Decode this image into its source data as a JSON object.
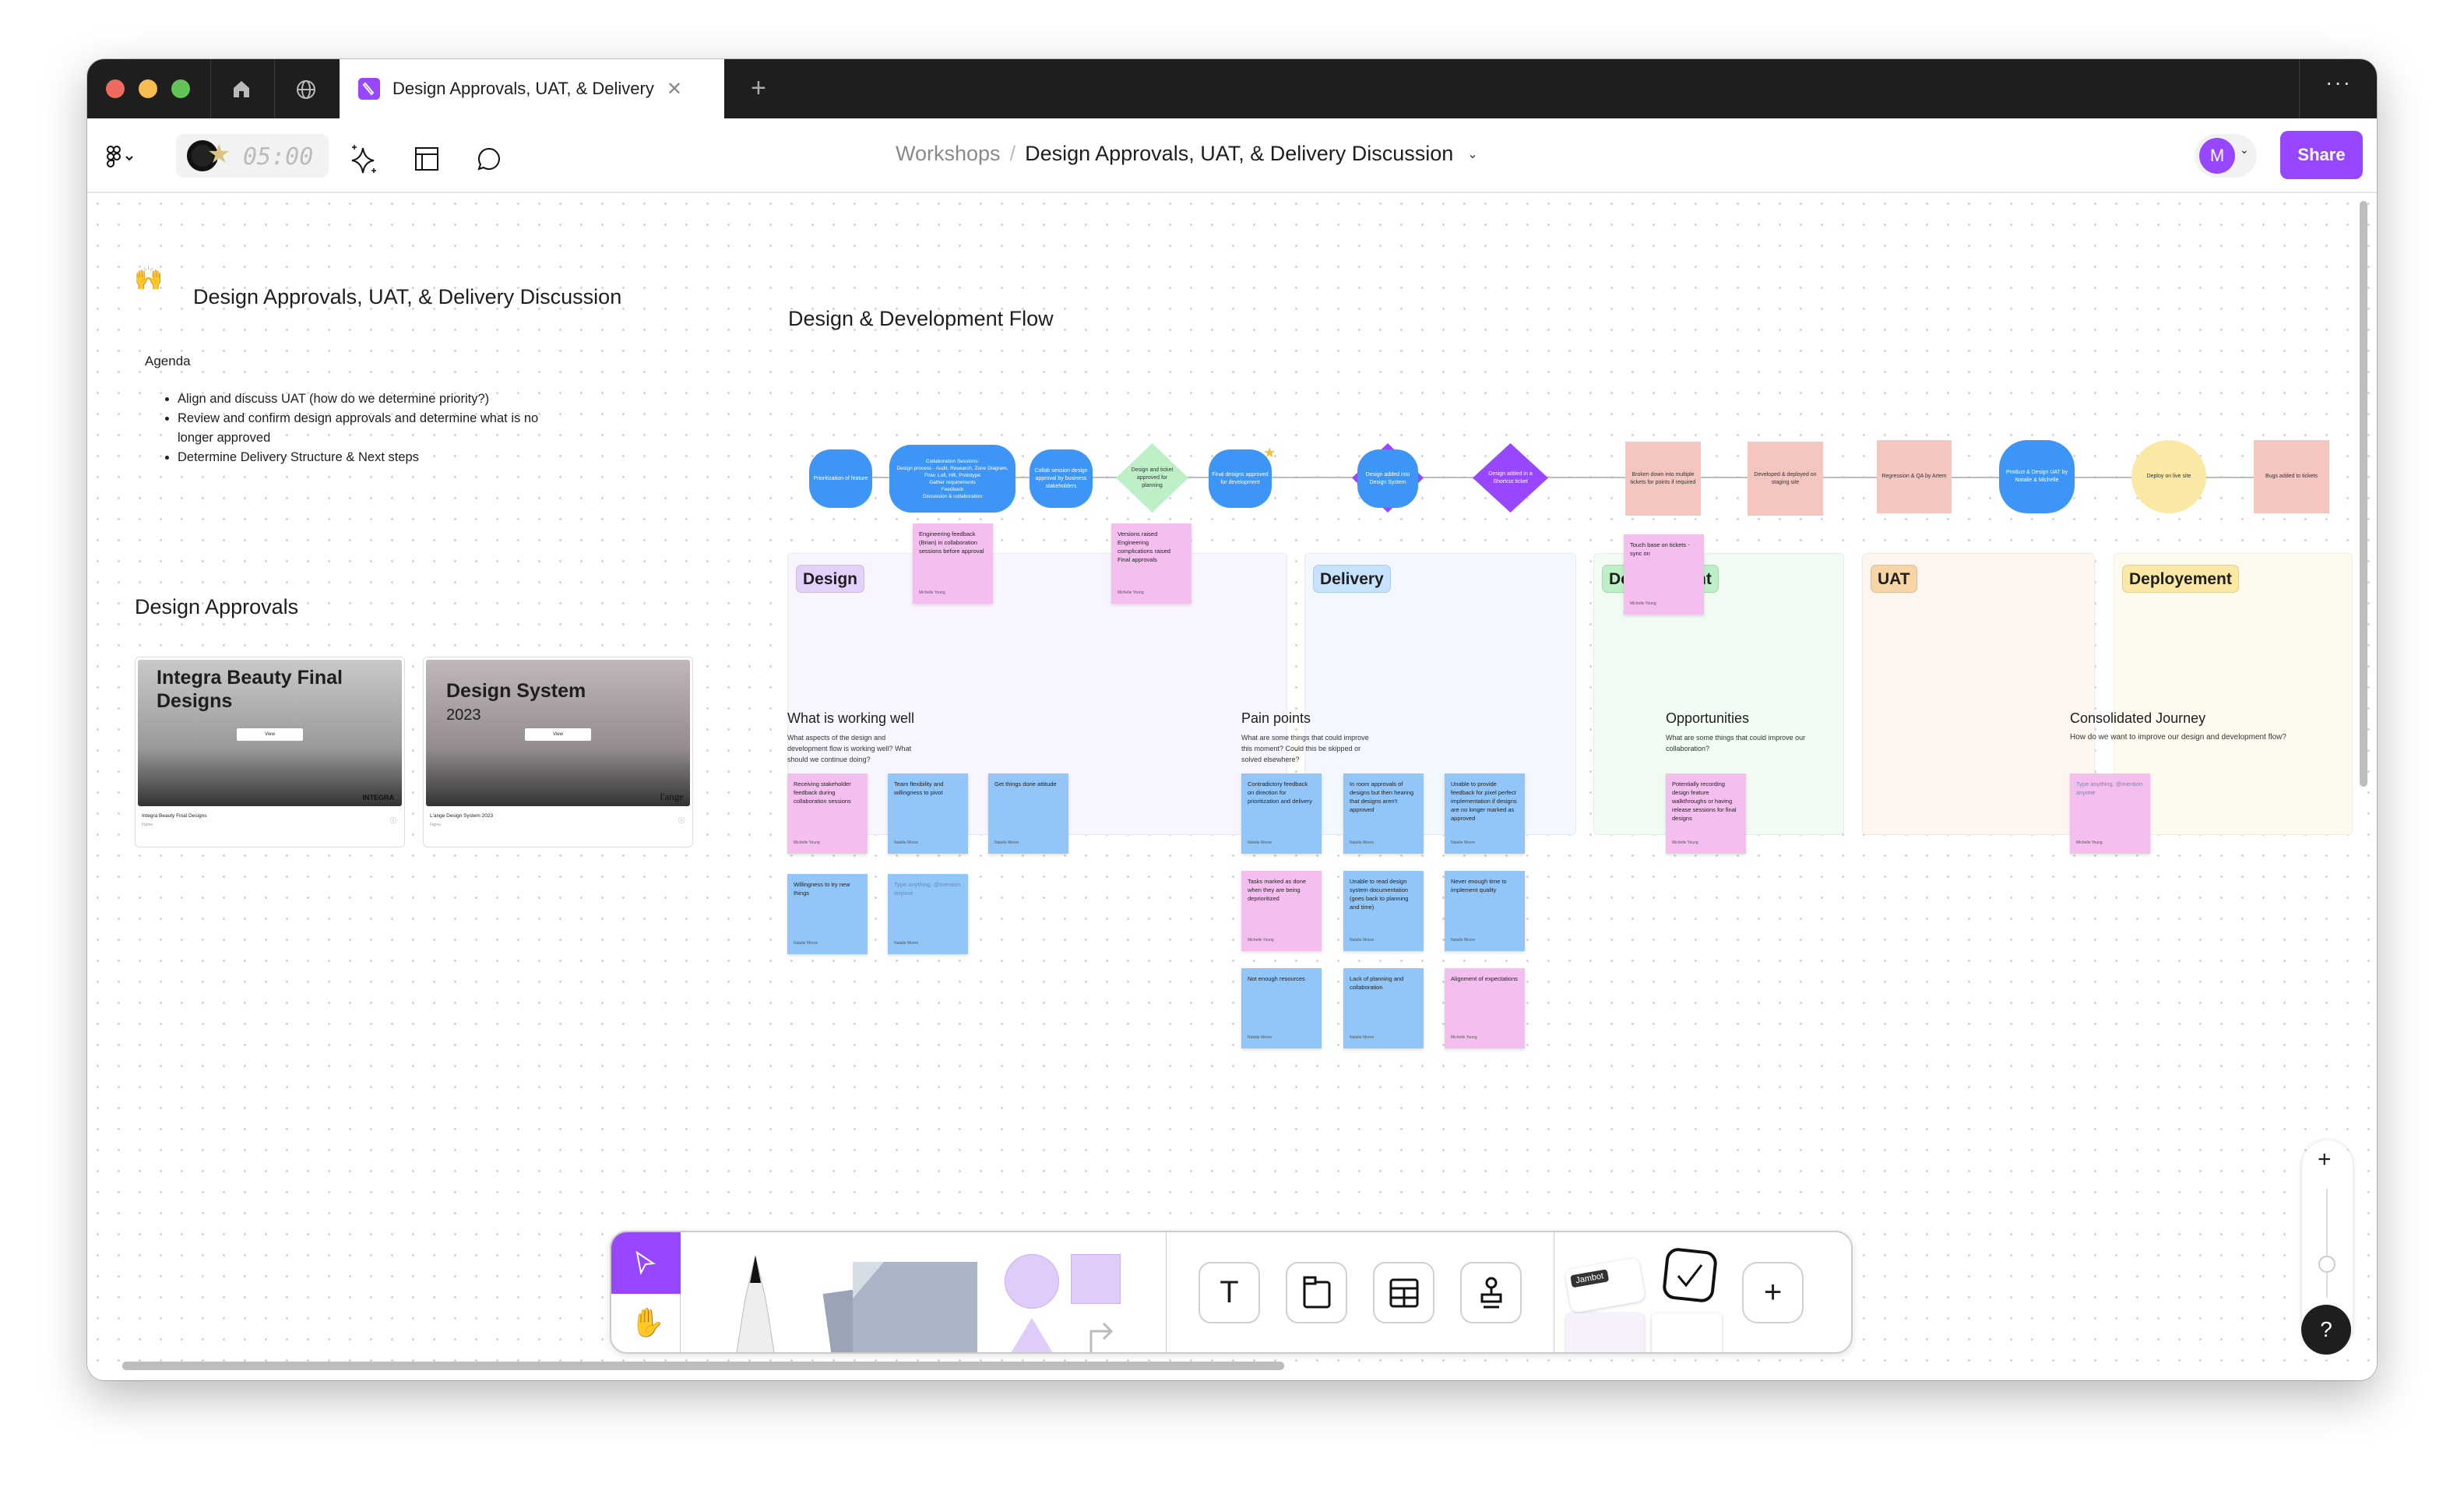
{
  "window": {
    "tab_title": "Design Approvals, UAT, & Delivery",
    "colors": {
      "close": "#ee6a5f",
      "min": "#f5bd4f",
      "max": "#61c454"
    }
  },
  "toolbar": {
    "timer": "05:00",
    "breadcrumb_parent": "Workshops",
    "breadcrumb_sep": "/",
    "file_title": "Design Approvals, UAT, & Delivery Discussion",
    "avatar_initial": "M",
    "share_label": "Share",
    "accent": "#9747ff"
  },
  "board": {
    "title": "Design Approvals, UAT, & Delivery Discussion",
    "agenda_label": "Agenda",
    "agenda": [
      "Align and discuss UAT (how do we determine priority?)",
      "Review and confirm design approvals and determine what is no longer approved",
      "Determine Delivery Structure & Next steps"
    ],
    "approvals_title": "Design Approvals",
    "cards": [
      {
        "heading": "Integra Beauty Final Designs",
        "view": "View",
        "logo": "INTEGRA",
        "name": "Integra Beauty Final Designs",
        "source": "Figma"
      },
      {
        "heading": "Design System",
        "year": "2023",
        "view": "View",
        "logo": "l'ange",
        "name": "L'ange Design System 2023",
        "source": "Figma"
      }
    ],
    "flow_title": "Design & Development Flow",
    "lanes": [
      {
        "label": "Design",
        "bg": "#f9f5fe",
        "pill": "#e3d0fb"
      },
      {
        "label": "Delivery",
        "bg": "#f3f8fe",
        "pill": "#c7e2fc"
      },
      {
        "label": "Development",
        "bg": "#f1fbf2",
        "pill": "#bef0c8"
      },
      {
        "label": "UAT",
        "bg": "#fdf5ef",
        "pill": "#f7d5a6"
      },
      {
        "label": "Deployement",
        "bg": "#fefbee",
        "pill": "#fae8a5"
      }
    ],
    "nodes": {
      "prioritization": "Prioritization of feature",
      "collab_title": "Collaboration Sessions:",
      "collab_items": [
        "Design process - Audit, Research, Zone Diagram, Flow, Lofi, Hifi, Prototype",
        "Gather requirements",
        "Feedback",
        "Discussion & collaboration"
      ],
      "collab_session": "Collab session design approval by business stakeholders",
      "approved_planning": "Design and ticket approved for planning",
      "final_designs": "Final designs approved for development",
      "design_system": "Design added into Design System",
      "shortcut": "Design added in a Shortcut ticket",
      "broken_down": "Broken down into multiple tickets for points if required",
      "staging": "Developed & deployed on staging site",
      "regression": "Regression & QA by Artem",
      "product_uat": "Product & Design UAT by Natalie & Michelle",
      "deploy_live": "Deploy on live site",
      "bugs": "Bugs added to tickets"
    },
    "flow_stickies": [
      {
        "text": "Engineering feedback (Brian) in collaboration sessions before approval",
        "author": "Michelle Young"
      },
      {
        "text": "Versions raised\nEngineering complications raised\nFinal approvals",
        "author": "Michelle Young"
      },
      {
        "text": "Touch base on tickets - sync on",
        "author": "Michelle Young"
      }
    ],
    "sticky_colors": {
      "pink": "#f4bfee",
      "blue": "#92c6f8"
    },
    "sections": [
      {
        "title": "What is working well",
        "subtitle": "What aspects of the design and development flow is working well? What should we continue doing?",
        "stickies": [
          {
            "text": "Receiving stakeholder feedback during collaboration sessions",
            "author": "Michelle Young",
            "color": "pink"
          },
          {
            "text": "Team flexibility and willingness to pivot",
            "author": "Natalie Moore",
            "color": "blue"
          },
          {
            "text": "Get things done attitude",
            "author": "Natalie Moore",
            "color": "blue"
          },
          {
            "text": "Willingness to try new things",
            "author": "Natalie Moore",
            "color": "blue"
          },
          {
            "text": "",
            "placeholder": "Type anything, @mention anyone",
            "author": "Natalie Moore",
            "color": "blue"
          }
        ]
      },
      {
        "title": "Pain points",
        "subtitle": "What are some things that could improve this moment? Could this be skipped or solved elsewhere?",
        "stickies": [
          {
            "text": "Contradictory feedback on direction for prioritization and delivery",
            "author": "Natalie Moore",
            "color": "blue"
          },
          {
            "text": "In room approvals of designs but then hearing that designs aren't approved",
            "author": "Natalie Moore",
            "color": "blue"
          },
          {
            "text": "Unable to provide feedback for pixel perfect implementation if designs are no longer marked as approved",
            "author": "Natalie Moore",
            "color": "blue"
          },
          {
            "text": "Tasks marked as done when they are being deprioritized",
            "author": "Michelle Young",
            "color": "pink"
          },
          {
            "text": "Unable to read design system documentation (goes back to planning and time)",
            "author": "Natalie Moore",
            "color": "blue"
          },
          {
            "text": "Never enough time to implement quality",
            "author": "Natalie Moore",
            "color": "blue"
          },
          {
            "text": "Not enough resources",
            "author": "Natalie Moore",
            "color": "blue"
          },
          {
            "text": "Lack of planning and collaboration",
            "author": "Natalie Moore",
            "color": "blue"
          },
          {
            "text": "Alignment of expectations",
            "author": "Michelle Young",
            "color": "pink"
          }
        ]
      },
      {
        "title": "Opportunities",
        "subtitle": "What are some things that could improve our collaboration?",
        "stickies": [
          {
            "text": "Potentially recording design feature walkthroughs or having release sessions for final designs",
            "author": "Michelle Young",
            "color": "pink"
          }
        ]
      },
      {
        "title": "Consolidated Journey",
        "subtitle": "How do we want to improve our design and development flow?",
        "stickies": [
          {
            "text": "",
            "placeholder": "Type anything, @mention anyone",
            "author": "Michelle Young",
            "color": "pink"
          }
        ]
      }
    ]
  },
  "bottom_toolbar": {
    "jambot_label": "Jambot"
  },
  "zoom": {
    "level": 0.4
  },
  "help_label": "?"
}
